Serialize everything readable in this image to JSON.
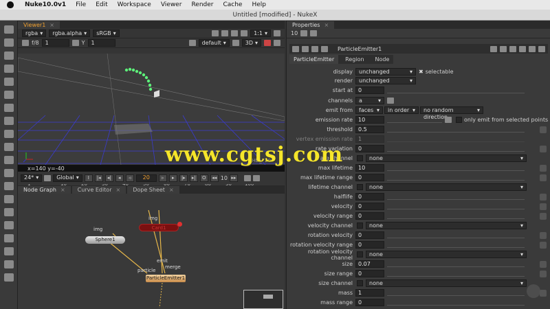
{
  "menubar": {
    "app": "Nuke10.0v1",
    "items": [
      "File",
      "Edit",
      "Workspace",
      "Viewer",
      "Render",
      "Cache",
      "Help"
    ]
  },
  "window_title": "Untitled [modified] - NukeX",
  "viewer": {
    "tab": "Viewer1",
    "channels": "rgba",
    "alpha": "rgba.alpha",
    "colorspace": "sRGB",
    "zoom": "1:1",
    "fstop": "f/8",
    "frame_a": "1",
    "y_label": "Y",
    "gain": "1",
    "lut": "default",
    "mode": "3D",
    "format": "HD_720",
    "coords": "x=140 y=-40"
  },
  "timeline": {
    "ticks": [
      "1",
      "10",
      "20",
      "30",
      "40",
      "50",
      "60",
      "70",
      "80",
      "90",
      "100"
    ],
    "current": "20",
    "fps": "24*",
    "scope": "Global",
    "step": "10"
  },
  "nodegraph": {
    "tabs": [
      "Node Graph",
      "Curve Editor",
      "Dope Sheet"
    ],
    "nodes": {
      "sphere": "Sphere1",
      "card": "Card1",
      "emitter": "ParticleEmitter1"
    },
    "labels": {
      "img1": "img",
      "img2": "img",
      "emit": "emit",
      "merge": "merge",
      "particle": "particle"
    }
  },
  "properties": {
    "title": "Properties",
    "count": "10",
    "node_name": "ParticleEmitter1",
    "tabs": [
      "ParticleEmitter",
      "Region",
      "Node"
    ],
    "display": "unchanged",
    "selectable": "selectable",
    "render": "unchanged",
    "start_at": "0",
    "channels": "a",
    "emit_from": "faces",
    "emit_order": "in order",
    "direction": "no random direction",
    "emission_rate": "10",
    "emit_selected": "only emit from selected points",
    "threshold": "0.5",
    "vertex_emission_rate": "1",
    "rate_variation": "0",
    "rate_channel": "none",
    "max_lifetime": "10",
    "max_lifetime_range": "0",
    "lifetime_channel": "none",
    "halflife": "0",
    "velocity": "0",
    "velocity_range": "0",
    "velocity_channel": "none",
    "rotation_velocity": "0",
    "rotation_velocity_range": "0",
    "rotation_velocity_channel": "none",
    "size": "0.07",
    "size_range": "0",
    "size_channel": "none",
    "mass": "1",
    "mass_range": "0",
    "labels": {
      "display": "display",
      "render": "render",
      "start_at": "start at",
      "channels": "channels",
      "emit_from": "emit from",
      "emission_rate": "emission rate",
      "threshold": "threshold",
      "vertex_emission_rate": "vertex emission rate",
      "rate_variation": "rate variation",
      "rate_channel": "rate channel",
      "max_lifetime": "max lifetime",
      "max_lifetime_range": "max lifetime range",
      "lifetime_channel": "lifetime channel",
      "halflife": "halflife",
      "velocity": "velocity",
      "velocity_range": "velocity range",
      "velocity_channel": "velocity channel",
      "rotation_velocity": "rotation velocity",
      "rotation_velocity_range": "rotation velocity range",
      "rotation_velocity_channel": "rotation velocity channel",
      "size": "size",
      "size_range": "size range",
      "size_channel": "size channel",
      "mass": "mass",
      "mass_range": "mass range"
    }
  },
  "watermark": "www.cgtsj.com",
  "colors": {
    "accent": "#f0a030",
    "particle": "#5df07a",
    "grid": "#3b3bd0",
    "watermark": "#f5e52a"
  }
}
